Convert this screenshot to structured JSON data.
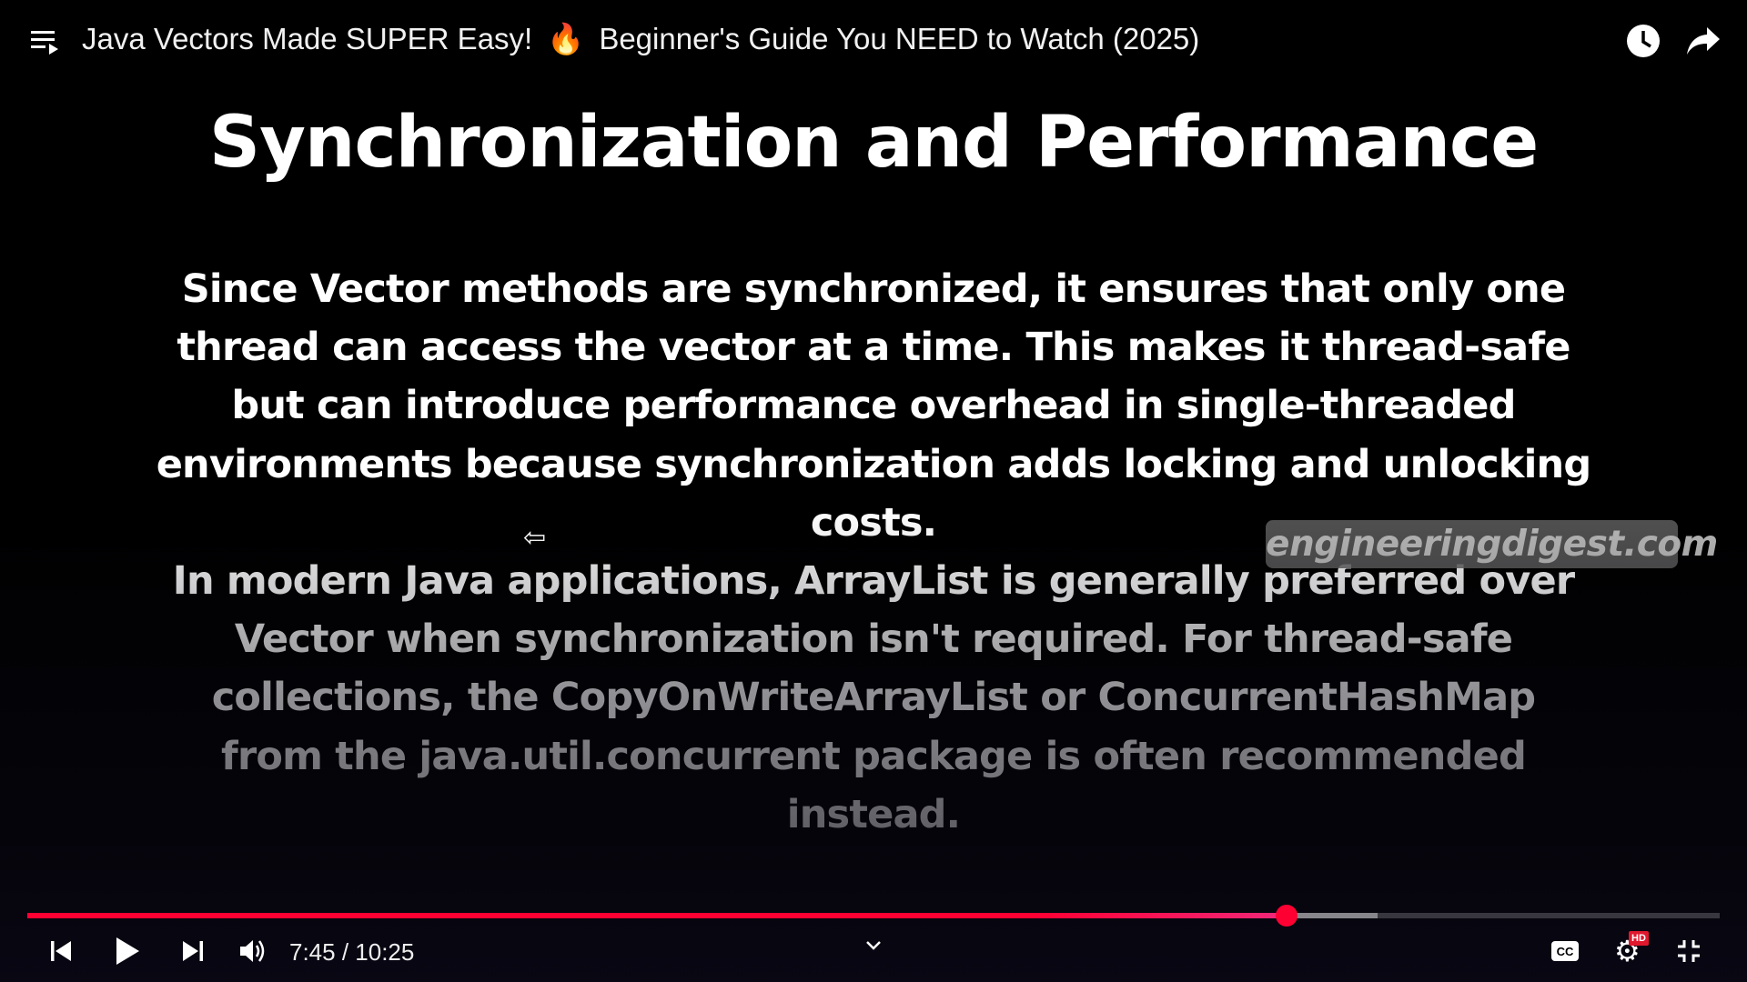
{
  "header": {
    "title_part1": "Java Vectors Made SUPER Easy!",
    "title_emoji": "🔥",
    "title_part2": "Beginner's Guide You NEED to Watch (2025)",
    "icons": [
      "playlist-icon",
      "watch-later-icon",
      "share-icon"
    ]
  },
  "slide": {
    "heading": "Synchronization and Performance",
    "lines": [
      "Since Vector methods are synchronized, it ensures that only one",
      "thread can access the vector at a time. This makes it thread-safe",
      "but can introduce performance overhead in single-threaded",
      "environments because synchronization adds locking and unlocking",
      "costs.",
      "In modern Java applications, ArrayList is generally preferred over",
      "Vector when synchronization isn't required. For thread-safe",
      "collections, the CopyOnWriteArrayList or ConcurrentHashMap",
      "from the java.util.concurrent package is often recommended",
      "instead."
    ],
    "watermark": "engineeringdigest.com"
  },
  "player": {
    "current_time": "7:45",
    "duration": "10:25",
    "time_display": "7:45 / 10:25",
    "progress_fraction": 0.744,
    "buffered_fraction": 0.798,
    "quality_badge": "HD",
    "cc_label": "CC",
    "accent_color": "#ff0033"
  }
}
